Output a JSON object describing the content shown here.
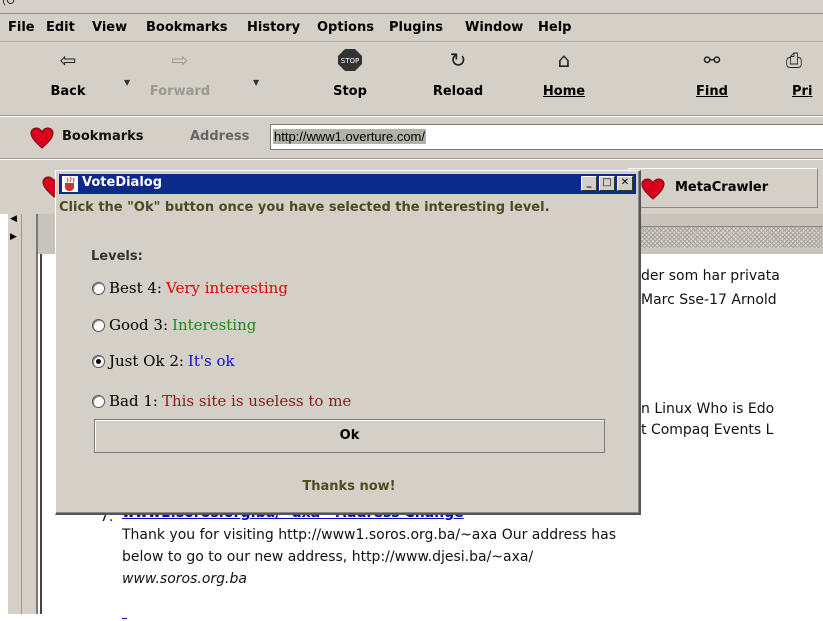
{
  "window": {
    "title_fragment": "(O"
  },
  "menu": [
    "File",
    "Edit",
    "View",
    "Bookmarks",
    "History",
    "Options",
    "Plugins",
    "Window",
    "Help"
  ],
  "toolbar": {
    "back": "Back",
    "forward": "Forward",
    "stop": "Stop",
    "reload": "Reload",
    "home": "Home",
    "find": "Find",
    "print": "Pri"
  },
  "address_bar": {
    "bookmarks_label": "Bookmarks",
    "address_label": "Address",
    "url": "http://www1.overture.com/"
  },
  "personal_toolbar": {
    "metacrawler": "MetaCrawler"
  },
  "page": {
    "line1": "der som har privata",
    "line2": "Marc Sse-17 Arnold",
    "line3": "n Linux Who is Edo",
    "line4": "t Compaq Events L",
    "result7_number": "7.",
    "result7_link": "www1.soros.org.ba/~axa - Address Change",
    "result7_desc1": "Thank you for visiting http://www1.soros.org.ba/~axa Our address has",
    "result7_desc2": "below to go to our new address, http://www.djesi.ba/~axa/",
    "result7_url": "www.soros.org.ba"
  },
  "dialog": {
    "title": "VoteDialog",
    "instruction": "Click the \"Ok\" button once you have selected the interesting level.",
    "levels_label": "Levels:",
    "options": [
      {
        "label": "Best 4:",
        "desc": "Very interesting",
        "color": "#e00000",
        "selected": false
      },
      {
        "label": "Good 3:",
        "desc": "Interesting",
        "color": "#1a8a1a",
        "selected": false
      },
      {
        "label": "Just Ok 2:",
        "desc": "It's ok",
        "color": "#1010d0",
        "selected": true
      },
      {
        "label": "Bad 1:",
        "desc": "This site is useless to me",
        "color": "#8a1a1a",
        "selected": false
      }
    ],
    "ok_button": "Ok",
    "status": "Thanks now!"
  }
}
